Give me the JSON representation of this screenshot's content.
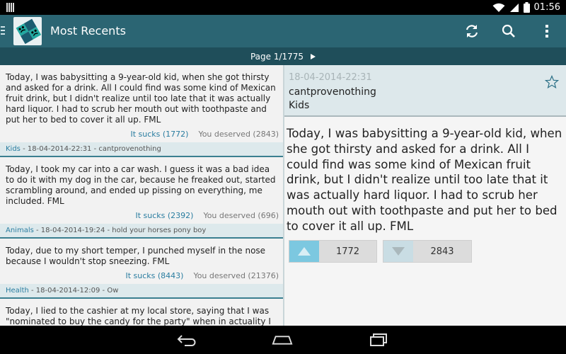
{
  "status_bar": {
    "time": "01:56",
    "icons": [
      "notification-icon",
      "wifi-icon",
      "signal-icon",
      "battery-icon"
    ]
  },
  "action_bar": {
    "title": "Most Recents",
    "actions": [
      "refresh-icon",
      "search-icon",
      "overflow-menu-icon"
    ]
  },
  "pager": {
    "label": "Page 1/1775"
  },
  "list": {
    "items": [
      {
        "text": "Today, I was babysitting a 9-year-old kid, when she got thirsty and asked for a drink. All I could find was some kind of Mexican fruit drink, but I didn't realize until too late that it was actually hard liquor. I had to scrub her mouth out with toothpaste and put her to bed to cover it all up. FML",
        "sucks": "It sucks (1772)",
        "deserved": "You deserved (2843)",
        "category": "Kids",
        "meta": " - 18-04-2014-22:31 - cantprovenothing"
      },
      {
        "text": "Today, I took my car into a car wash. I guess it was a bad idea to do it with my dog in the car, because he freaked out, started scrambling around, and ended up pissing on everything, me included. FML",
        "sucks": "It sucks (2392)",
        "deserved": "You deserved (696)",
        "category": "Animals",
        "meta": " - 18-04-2014-19:24 - hold your horses pony boy"
      },
      {
        "text": "Today, due to my short temper, I punched myself in the nose because I wouldn't stop sneezing. FML",
        "sucks": "It sucks (8443)",
        "deserved": "You deserved (21376)",
        "category": "Health",
        "meta": " - 18-04-2014-12:09 - Ow"
      },
      {
        "text": "Today, I lied to the cashier at my local store, saying that I was \"nominated to buy the candy for the party\" when in actuality I went home and gorged on it alone. FML",
        "sucks": "",
        "deserved": "",
        "category": "",
        "meta": ""
      }
    ]
  },
  "detail": {
    "date": "18-04-2014-22:31",
    "author": "cantprovenothing",
    "category": "Kids",
    "body": "Today, I was babysitting a 9-year-old kid, when she got thirsty and asked for a drink. All I could find was some kind of Mexican fruit drink, but I didn't realize until too late that it was actually hard liquor. I had to scrub her mouth out with toothpaste and put her to bed to cover it all up. FML",
    "upvotes": "1772",
    "downvotes": "2843"
  },
  "colors": {
    "action_bar": "#2b6573",
    "pager_bar": "#1f4e5a",
    "accent": "#2a7da0",
    "up_button": "#7cc8e0",
    "down_button": "#c9dde4"
  },
  "nav_bar": {
    "buttons": [
      "back-icon",
      "home-icon",
      "recent-apps-icon"
    ]
  }
}
